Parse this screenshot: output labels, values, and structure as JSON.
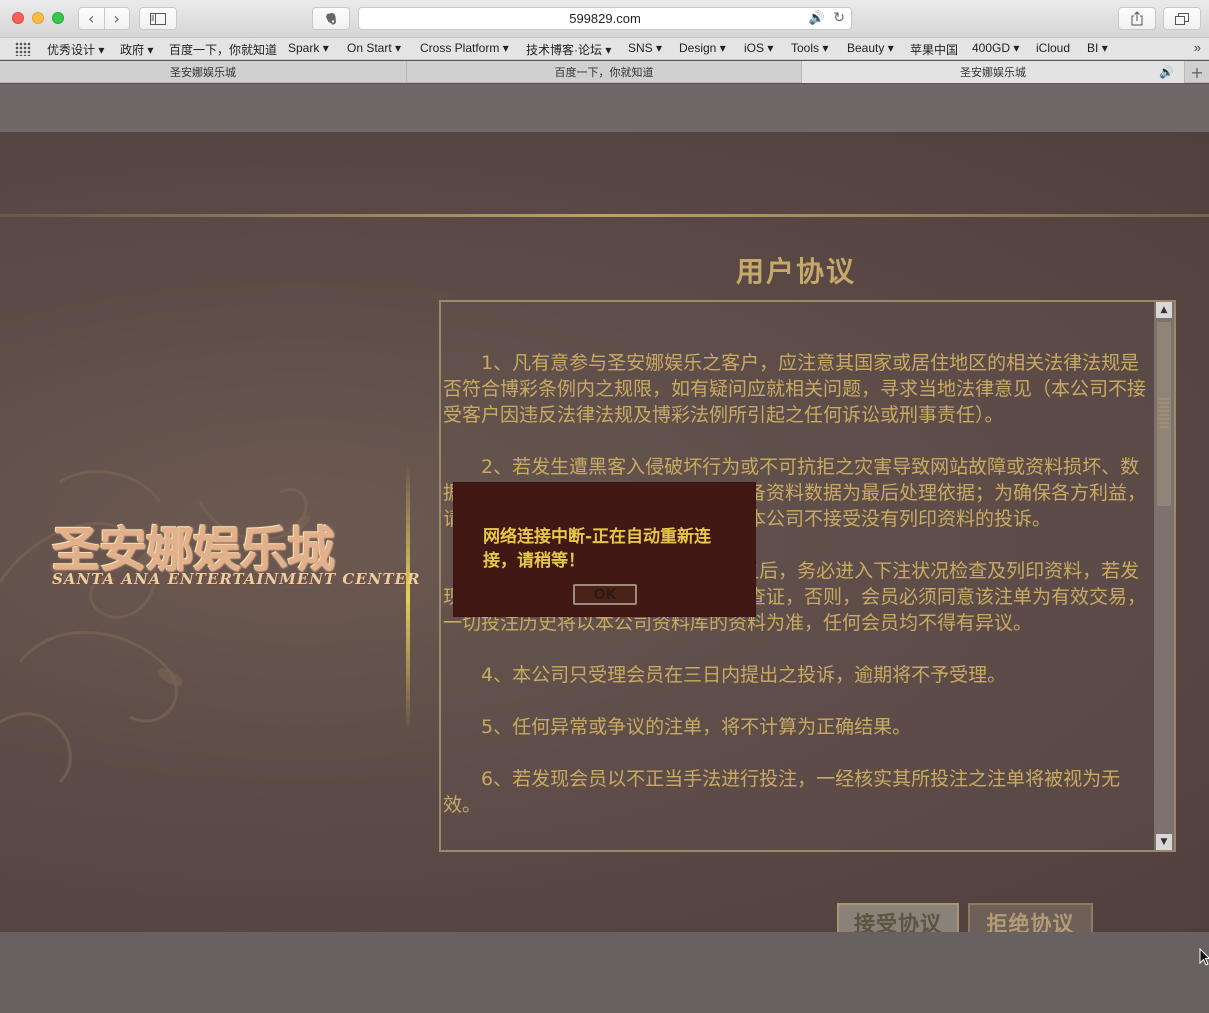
{
  "browser": {
    "url": "599829.com",
    "bookmarks": [
      "优秀设计",
      "政府",
      "百度一下，你就知道",
      "Spark",
      "On Start",
      "Cross Platform",
      "技术博客·论坛",
      "SNS",
      "Design",
      "iOS",
      "Tools",
      "Beauty",
      "苹果中国",
      "400GD",
      "iCloud",
      "BI"
    ],
    "bookmark_dropdown_icon": "▾",
    "bookmarks_overflow": "»",
    "tabs": [
      "圣安娜娱乐城",
      "百度一下，你就知道",
      "圣安娜娱乐城"
    ],
    "new_tab": "+"
  },
  "site": {
    "logo": "圣安娜娱乐城",
    "logo_subtitle": "SANTA ANA ENTERTAINMENT CENTER"
  },
  "agreement": {
    "title": "用户协议",
    "paragraphs": [
      "1、凡有意参与圣安娜娱乐之客户，应注意其国家或居住地区的相关法律法规是否符合博彩条例内之规限，如有疑问应就相关问题，寻求当地法律意见（本公司不接受客户因违反法律法规及博彩法例所引起之任何诉讼或刑事责任）。",
      "2、若发生遭黑客入侵破坏行为或不可抗拒之灾害导致网站故障或资料损坏、数据丢失等情况，我们将以本公司之后备资料数据为最后处理依据；为确保各方利益，请各会员投注后列印资料作为存根，本公司不接受没有列印资料的投诉。",
      "3、会员在本公司网站进行投注之后，务必进入下注状况检查及列印资料，若发现任何异常，请立即与代理商联络及查证，否则，会员必须同意该注单为有效交易，一切投注历史将以本公司资料库的资料为准，任何会员均不得有异议。",
      "4、本公司只受理会员在三日内提出之投诉，逾期将不予受理。",
      "5、任何异常或争议的注单，将不计算为正确结果。",
      "6、若发现会员以不正当手法进行投注，一经核实其所投注之注单将被视为无效。"
    ],
    "accept_label": "接受协议",
    "decline_label": "拒绝协议"
  },
  "modal": {
    "message": "网络连接中断-正在自动重新连接，请稍等！",
    "ok_label": "OK"
  },
  "colors": {
    "accent": "#c9aa62",
    "modal_bg": "#421814",
    "modal_text": "#e5c74a"
  }
}
